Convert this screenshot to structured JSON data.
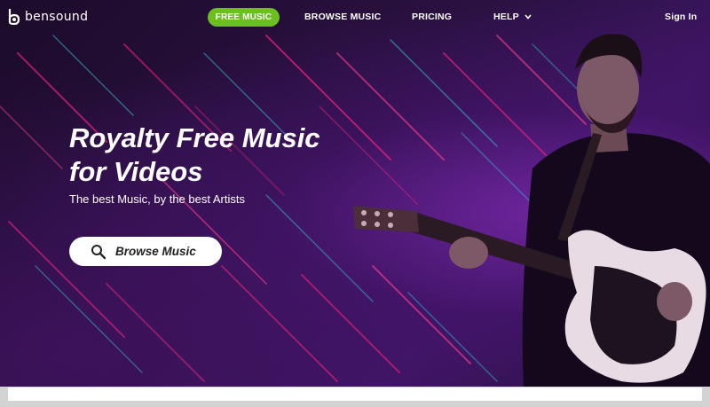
{
  "brand": {
    "name": "bensound",
    "icon": "bensound-logo-icon"
  },
  "nav": {
    "free_music": "FREE MUSIC",
    "browse_music": "BROWSE MUSIC",
    "pricing": "PRICING",
    "help": "HELP",
    "sign_in": "Sign In"
  },
  "hero": {
    "title_line1": "Royalty Free Music",
    "title_line2": "for Videos",
    "subtitle": "The best Music, by the best Artists",
    "cta_label": "Browse Music",
    "cta_icon": "search-icon"
  },
  "colors": {
    "accent_green": "#6cbf1e",
    "hero_background": "#2b1142",
    "streak_pink": "#e0207a",
    "streak_cyan": "#2ec4d6"
  }
}
